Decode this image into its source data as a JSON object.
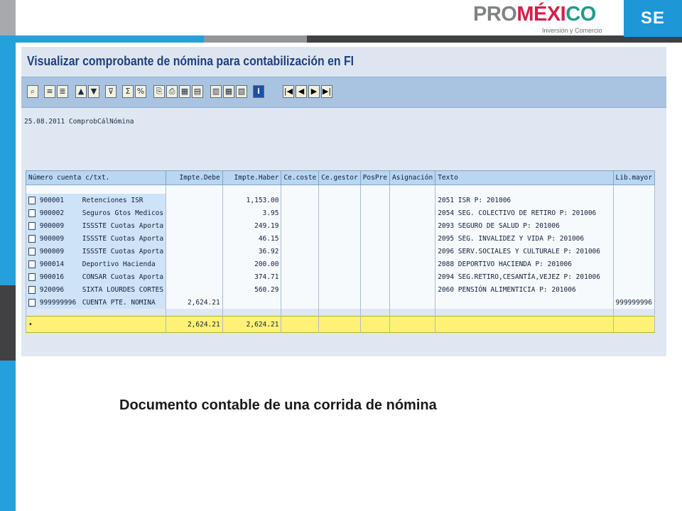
{
  "logo": {
    "part_pro": "PRO",
    "part_mex": "MÉXI",
    "part_co": "CO",
    "subtitle": "Inversión y Comercio"
  },
  "agency_badge": "SE",
  "sap": {
    "title": "Visualizar comprobante de nómina para contabilización en FI",
    "toolbar_icons": [
      "details-icon",
      "select-icon",
      "layout-icon",
      "find-icon",
      "find-next-icon",
      "filter-icon",
      "sum-icon",
      "subtotal-icon",
      "export-icon",
      "print-icon",
      "spreadsheet-icon",
      "word-icon",
      "graphic-icon",
      "grid-icon",
      "columns-icon",
      "info-icon",
      "first-page-icon",
      "prev-page-icon",
      "next-page-icon",
      "last-page-icon"
    ],
    "nav_glyphs": {
      "first": "|◀",
      "prev": "◀",
      "next": "▶",
      "last": "▶|"
    },
    "info_glyph": "i",
    "header_line": "25.08.2011 ComprobCálNómina",
    "columns": [
      "Número cuenta c/txt.",
      "Impte.Debe",
      "Impte.Haber",
      "Ce.coste",
      "Ce.gestor",
      "PosPre",
      "Asignación",
      "Texto",
      "Lib.mayor"
    ],
    "rows": [
      {
        "acct": "900001",
        "name": "Retenciones ISR",
        "debe": "",
        "haber": "1,153.00",
        "texto": "2051 ISR P: 201006",
        "mayor": ""
      },
      {
        "acct": "900002",
        "name": "Seguros Gtos Medicos",
        "debe": "",
        "haber": "3.95",
        "texto": "2054 SEG. COLECTIVO DE RETIRO P: 201006",
        "mayor": ""
      },
      {
        "acct": "900009",
        "name": "ISSSTE Cuotas Aporta",
        "debe": "",
        "haber": "249.19",
        "texto": "2093 SEGURO DE SALUD P: 201006",
        "mayor": ""
      },
      {
        "acct": "900009",
        "name": "ISSSTE Cuotas Aporta",
        "debe": "",
        "haber": "46.15",
        "texto": "2095 SEG. INVALIDEZ Y VIDA P: 201006",
        "mayor": ""
      },
      {
        "acct": "900009",
        "name": "ISSSTE Cuotas Aporta",
        "debe": "",
        "haber": "36.92",
        "texto": "2096 SERV.SOCIALES Y CULTURALE P: 201006",
        "mayor": ""
      },
      {
        "acct": "900014",
        "name": "Deportivo Hacienda",
        "debe": "",
        "haber": "200.00",
        "texto": "2088 DEPORTIVO HACIENDA P: 201006",
        "mayor": ""
      },
      {
        "acct": "900016",
        "name": "CONSAR Cuotas Aporta",
        "debe": "",
        "haber": "374.71",
        "texto": "2094 SEG.RETIRO,CESANTÍA,VEJEZ P: 201006",
        "mayor": ""
      },
      {
        "acct": "920096",
        "name": "SIXTA LOURDES CORTES",
        "debe": "",
        "haber": "560.29",
        "texto": "2060 PENSIÓN ALIMENTICIA P: 201006",
        "mayor": ""
      },
      {
        "acct": "999999996",
        "name": "CUENTA PTE. NOMINA",
        "debe": "2,624.21",
        "haber": "",
        "texto": "",
        "mayor": "999999996"
      }
    ],
    "total": {
      "mark": "•",
      "debe": "2,624.21",
      "haber": "2,624.21"
    }
  },
  "caption": "Documento contable de una corrida de nómina"
}
